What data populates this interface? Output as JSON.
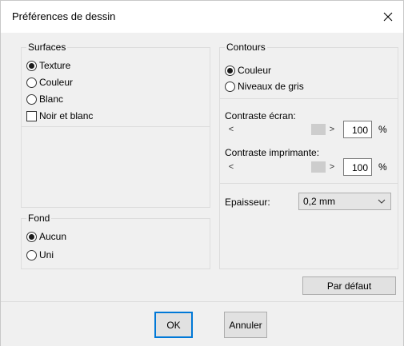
{
  "dialog": {
    "title": "Préférences de dessin"
  },
  "surfaces": {
    "legend": "Surfaces",
    "options": [
      {
        "label": "Texture",
        "checked": true
      },
      {
        "label": "Couleur",
        "checked": false
      },
      {
        "label": "Blanc",
        "checked": false
      }
    ],
    "bw_label": "Noir et blanc",
    "bw_checked": false
  },
  "fond": {
    "legend": "Fond",
    "options": [
      {
        "label": "Aucun",
        "checked": true
      },
      {
        "label": "Uni",
        "checked": false
      }
    ]
  },
  "contours": {
    "legend": "Contours",
    "options": [
      {
        "label": "Couleur",
        "checked": true
      },
      {
        "label": "Niveaux de gris",
        "checked": false
      }
    ]
  },
  "contrast": {
    "screen_label": "Contraste écran:",
    "screen_value": "100",
    "printer_label": "Contraste imprimante:",
    "printer_value": "100",
    "unit": "%",
    "left_arrow": "<",
    "right_arrow": ">"
  },
  "thickness": {
    "label": "Epaisseur:",
    "value": "0,2 mm"
  },
  "buttons": {
    "default": "Par défaut",
    "ok": "OK",
    "cancel": "Annuler"
  }
}
